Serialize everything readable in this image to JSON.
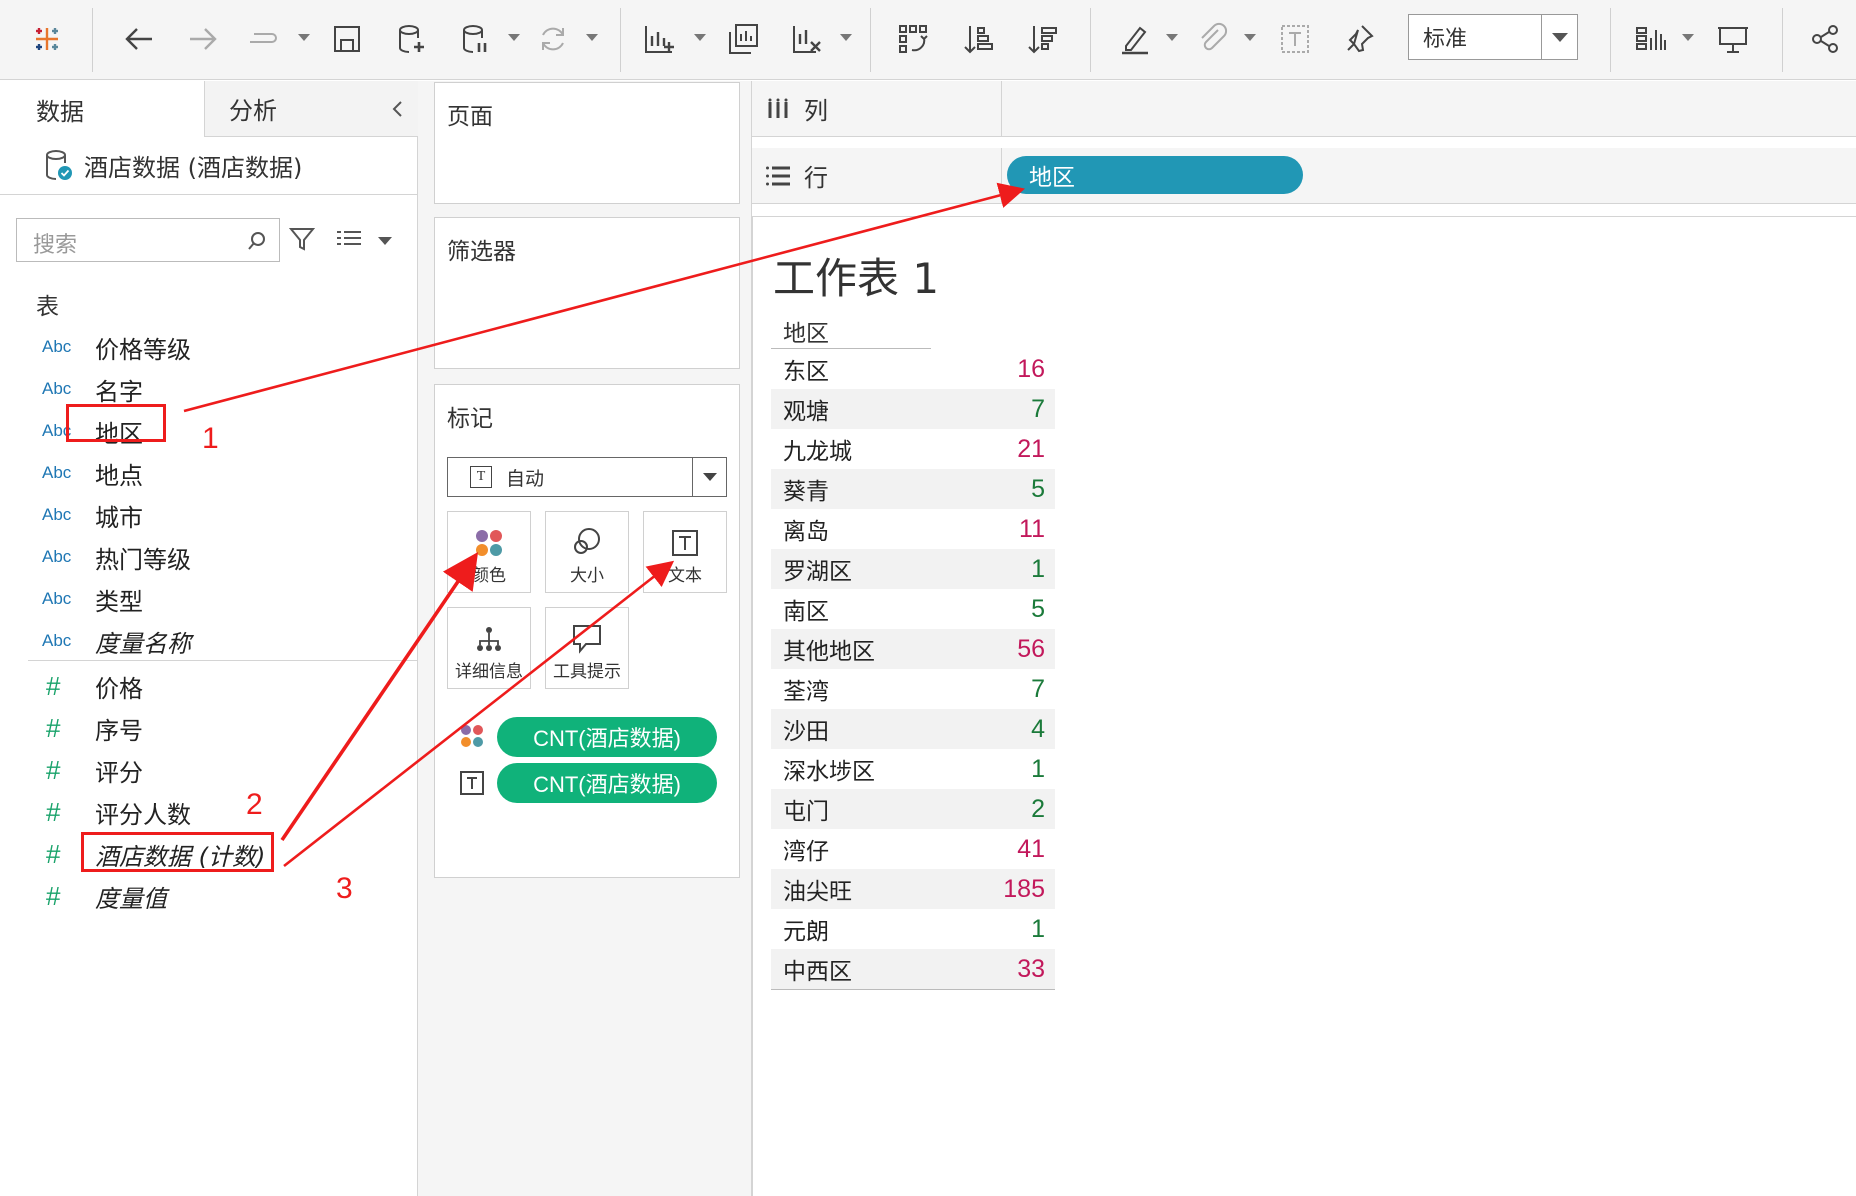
{
  "toolbar": {
    "view_mode": "标准",
    "icons": [
      "tableau-logo-icon",
      "back-icon",
      "forward-icon",
      "redo-icon",
      "save-icon",
      "new-datasource-icon",
      "pause-update-icon",
      "refresh-icon",
      "new-worksheet-icon",
      "duplicate-sheet-icon",
      "clear-sheet-icon",
      "swap-icon",
      "sort-ascending-icon",
      "sort-descending-icon",
      "highlight-icon",
      "attach-icon",
      "text-label-icon",
      "pin-icon",
      "show-me-icon",
      "presentation-icon",
      "share-icon"
    ]
  },
  "left": {
    "tabs": {
      "data": "数据",
      "analysis": "分析"
    },
    "datasource": "酒店数据 (酒店数据)",
    "search_placeholder": "搜索",
    "section": "表",
    "dimensions": [
      {
        "type": "Abc",
        "name": "价格等级"
      },
      {
        "type": "Abc",
        "name": "名字"
      },
      {
        "type": "Abc",
        "name": "地区"
      },
      {
        "type": "Abc",
        "name": "地点"
      },
      {
        "type": "Abc",
        "name": "城市"
      },
      {
        "type": "Abc",
        "name": "热门等级"
      },
      {
        "type": "Abc",
        "name": "类型"
      },
      {
        "type": "Abc",
        "name": "度量名称"
      }
    ],
    "measures": [
      {
        "type": "#",
        "name": "价格"
      },
      {
        "type": "#",
        "name": "序号"
      },
      {
        "type": "#",
        "name": "评分"
      },
      {
        "type": "#",
        "name": "评分人数"
      },
      {
        "type": "#",
        "name": "酒店数据 (计数)"
      },
      {
        "type": "#",
        "name": "度量值"
      }
    ]
  },
  "shelves": {
    "pages": "页面",
    "filters": "筛选器",
    "marks": "标记",
    "mark_type": "自动",
    "mark_buttons": {
      "color": "颜色",
      "size": "大小",
      "text": "文本",
      "detail": "详细信息",
      "tooltip": "工具提示"
    },
    "mark_pills": [
      "CNT(酒店数据)",
      "CNT(酒店数据)"
    ],
    "columns": "列",
    "rows": "行",
    "rows_pill": "地区"
  },
  "worksheet": {
    "title": "工作表 1",
    "header": "地区",
    "colors": {
      "high": "#c2185b",
      "low": "#1b7a3a"
    },
    "rows": [
      {
        "name": "东区",
        "value": "16",
        "level": "high"
      },
      {
        "name": "观塘",
        "value": "7",
        "level": "low"
      },
      {
        "name": "九龙城",
        "value": "21",
        "level": "high"
      },
      {
        "name": "葵青",
        "value": "5",
        "level": "low"
      },
      {
        "name": "离岛",
        "value": "11",
        "level": "high"
      },
      {
        "name": "罗湖区",
        "value": "1",
        "level": "low"
      },
      {
        "name": "南区",
        "value": "5",
        "level": "low"
      },
      {
        "name": "其他地区",
        "value": "56",
        "level": "high"
      },
      {
        "name": "荃湾",
        "value": "7",
        "level": "low"
      },
      {
        "name": "沙田",
        "value": "4",
        "level": "low"
      },
      {
        "name": "深水埗区",
        "value": "1",
        "level": "low"
      },
      {
        "name": "屯门",
        "value": "2",
        "level": "low"
      },
      {
        "name": "湾仔",
        "value": "41",
        "level": "high"
      },
      {
        "name": "油尖旺",
        "value": "185",
        "level": "high"
      },
      {
        "name": "元朗",
        "value": "1",
        "level": "low"
      },
      {
        "name": "中西区",
        "value": "33",
        "level": "high"
      }
    ]
  },
  "annotations": {
    "step1": "1",
    "step2": "2",
    "step3": "3",
    "color": "#ee1c1c"
  }
}
